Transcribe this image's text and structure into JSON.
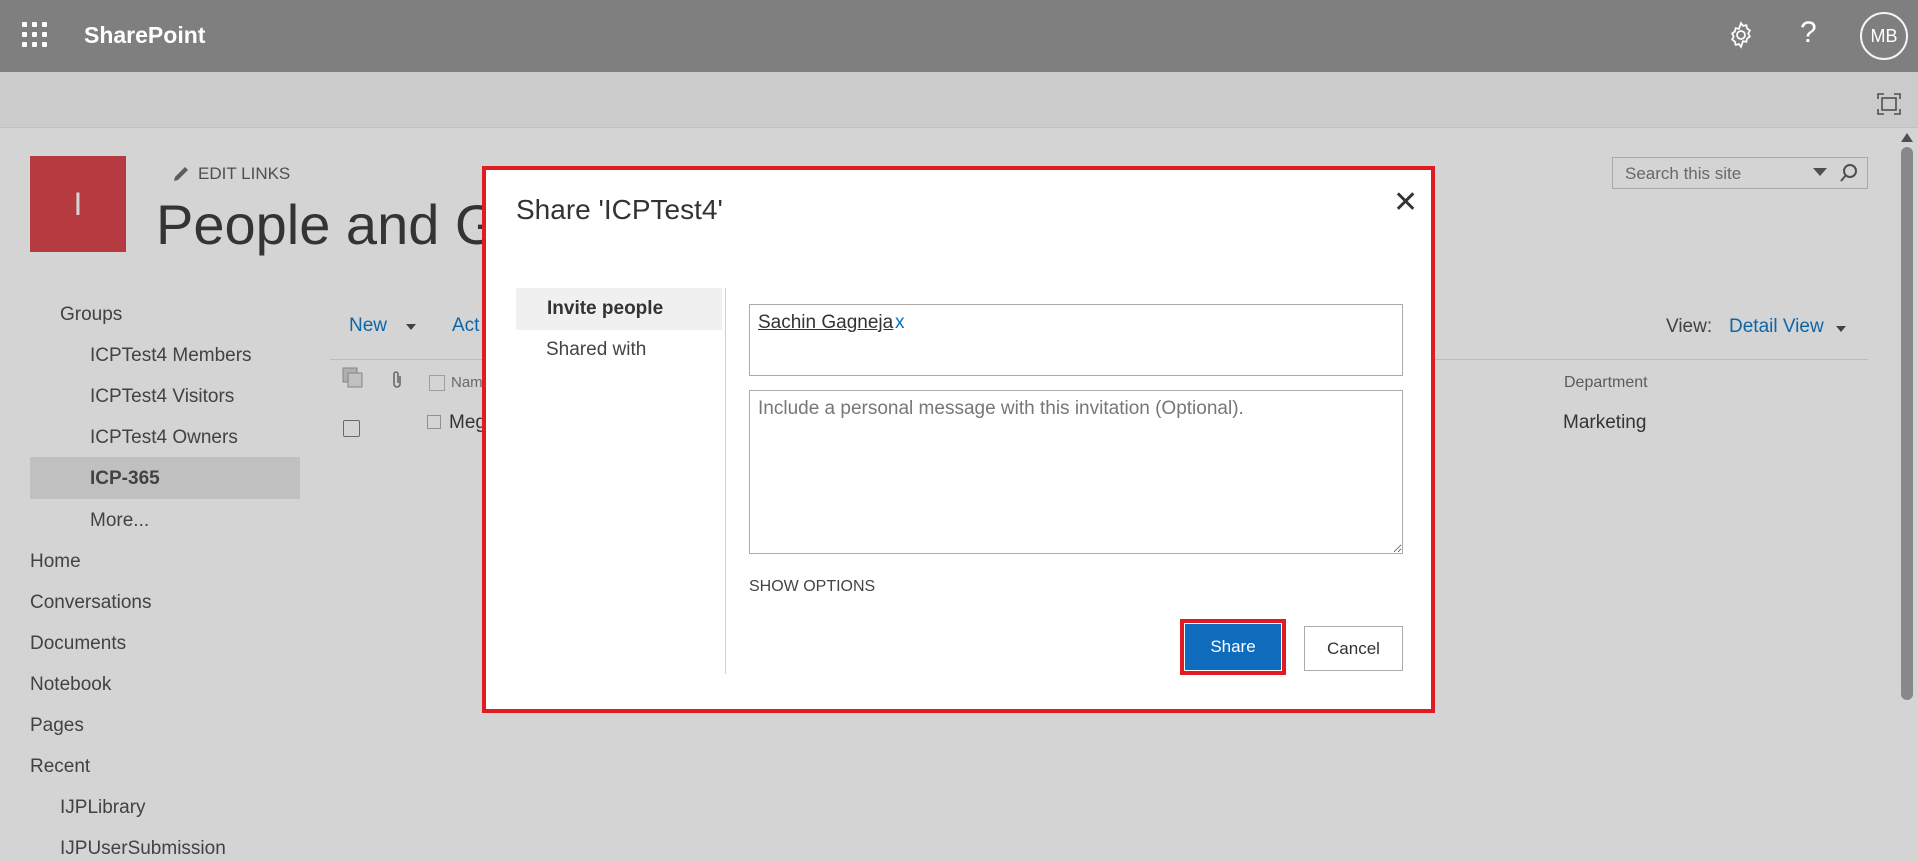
{
  "suite_bar": {
    "brand": "SharePoint",
    "avatar_initials": "MB",
    "help_glyph": "?",
    "icons": [
      "app-launcher-icon",
      "gear-icon",
      "help-icon"
    ]
  },
  "site": {
    "logo_letter": "I",
    "edit_links": "EDIT LINKS",
    "page_title": "People and Gro"
  },
  "search": {
    "placeholder": "Search this site"
  },
  "left_nav": {
    "items": [
      {
        "label": "Groups"
      },
      {
        "label": "ICPTest4 Members"
      },
      {
        "label": "ICPTest4 Visitors"
      },
      {
        "label": "ICPTest4 Owners"
      },
      {
        "label": "ICP-365"
      },
      {
        "label": "More..."
      },
      {
        "label": "Home"
      },
      {
        "label": "Conversations"
      },
      {
        "label": "Documents"
      },
      {
        "label": "Notebook"
      },
      {
        "label": "Pages"
      },
      {
        "label": "Recent"
      },
      {
        "label": "IJPLibrary"
      },
      {
        "label": "IJPUserSubmission"
      }
    ],
    "selected": "ICP-365"
  },
  "list": {
    "new_label": "New",
    "actions_label": "Act",
    "view_label": "View:",
    "view_value": "Detail View",
    "columns": {
      "name": "Nam",
      "department": "Department"
    },
    "rows": [
      {
        "name": "Meg",
        "department": "Marketing"
      }
    ]
  },
  "dialog": {
    "title": "Share 'ICPTest4'",
    "close_glyph": "✕",
    "tabs": [
      {
        "label": "Invite people",
        "selected": true
      },
      {
        "label": "Shared with",
        "selected": false
      }
    ],
    "invitee": "Sachin Gagneja",
    "invitee_remove": "x",
    "message_placeholder": "Include a personal message with this invitation (Optional).",
    "show_options": "SHOW OPTIONS",
    "share_label": "Share",
    "cancel_label": "Cancel"
  },
  "colors": {
    "suite_bar": "#7f7f7f",
    "accent": "#0072c6",
    "share_button": "#0f6cbd",
    "highlight_outline": "#e01b24",
    "site_logo": "#d83b42"
  }
}
